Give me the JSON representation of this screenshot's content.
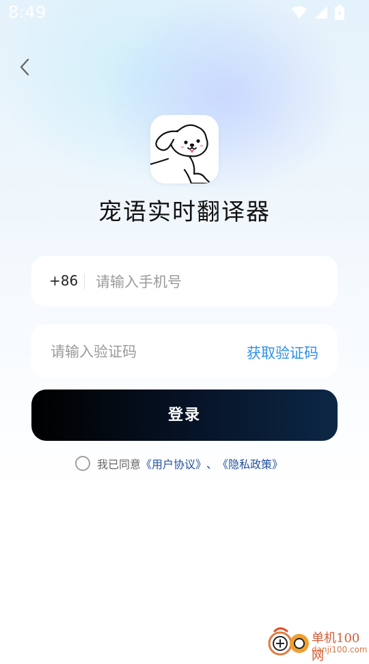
{
  "status_bar": {
    "time": "8:49",
    "icons": [
      "wifi-icon",
      "signal-icon",
      "battery-icon"
    ]
  },
  "nav": {
    "back_icon": "chevron-left-icon"
  },
  "app": {
    "title": "宠语实时翻译器",
    "logo_icon": "puppy-logo-icon"
  },
  "phone_field": {
    "country_code": "+86",
    "placeholder": "请输入手机号",
    "value": ""
  },
  "code_field": {
    "placeholder": "请输入验证码",
    "value": "",
    "get_code_label": "获取验证码"
  },
  "login_button": {
    "label": "登录"
  },
  "agreement": {
    "checked": false,
    "prefix": "我已同意",
    "user_agreement": "《用户协议》",
    "separator": "、",
    "privacy_policy": "《隐私政策》"
  },
  "watermark": {
    "brand": "单机100网",
    "url": "danji100.com"
  },
  "colors": {
    "accent_link": "#2f8fe8",
    "agreement_link": "#1f4fa0",
    "button_gradient_start": "#000000",
    "button_gradient_end": "#0c2746",
    "watermark": "#d75a34"
  }
}
